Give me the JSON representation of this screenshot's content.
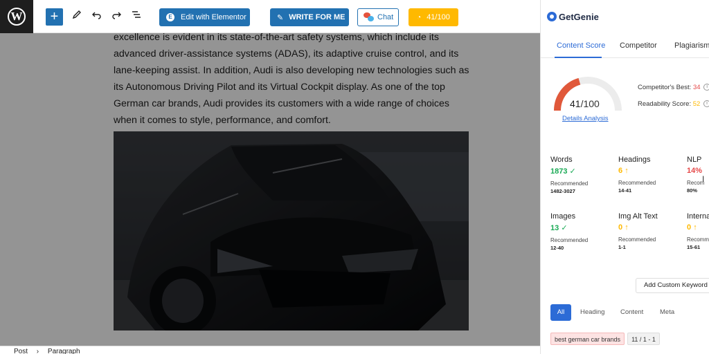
{
  "toolbar": {
    "wp_logo": "W",
    "add_icon": "+",
    "edit_elementor": "Edit with Elementor",
    "write_for_me": "WRITE FOR ME",
    "chat": "Chat",
    "score": "41/100"
  },
  "editor": {
    "lines": [
      "excellence is evident in its state-of-the-art safety systems, which include its",
      "advanced driver-assistance systems (ADAS), its adaptive cruise control, and its",
      "lane-keeping assist. In addition, Audi is also developing new technologies such as",
      "its Autonomous Driving Pilot and its Virtual Cockpit display. As one of the top",
      "German car brands, Audi provides its customers with a wide range of choices",
      "when it comes to style, performance, and comfort."
    ],
    "breadcrumb": [
      "Post",
      "›",
      "Paragraph"
    ]
  },
  "sidebar": {
    "brand": "GetGenie",
    "tabs": [
      "Content Score",
      "Competitor",
      "Plagiarism"
    ],
    "active_tab": "Content Score",
    "score": {
      "value": "41",
      "max": "/100",
      "fraction": 0.41
    },
    "details_link": "Details Analysis",
    "competitors_best_label": "Competitor's Best:",
    "competitors_best_value": "34",
    "readability_label": "Readability Score:",
    "readability_value": "52",
    "stats": [
      {
        "label": "Words",
        "value": "1873",
        "status": "✓",
        "rec_label": "Recommended",
        "range": "1482-3027"
      },
      {
        "label": "Headings",
        "value": "6",
        "status": "↑",
        "rec_label": "Recommended",
        "range": "14-41"
      },
      {
        "label": "NLP",
        "value": "14%",
        "status": "",
        "rec_label": "Recom",
        "range": "80%"
      },
      {
        "label": "Images",
        "value": "13",
        "status": "✓",
        "rec_label": "Recommended",
        "range": "12-40"
      },
      {
        "label": "Img Alt Text",
        "value": "0",
        "status": "↑",
        "rec_label": "Recommended",
        "range": "1-1"
      },
      {
        "label": "Interna",
        "value": "0",
        "status": "↑",
        "rec_label": "Recommended",
        "range": "15-61"
      }
    ],
    "add_keyword": "Add Custom Keyword",
    "filters": [
      "All",
      "Heading",
      "Content",
      "Meta"
    ],
    "keyword": {
      "text": "best german car brands",
      "count": "11 / 1 - 1"
    }
  },
  "colors": {
    "accent": "#2271b1",
    "genie_blue": "#2c6bd6",
    "score_yellow": "#ffb900",
    "good": "#1aaa55",
    "bad": "#e54848"
  }
}
